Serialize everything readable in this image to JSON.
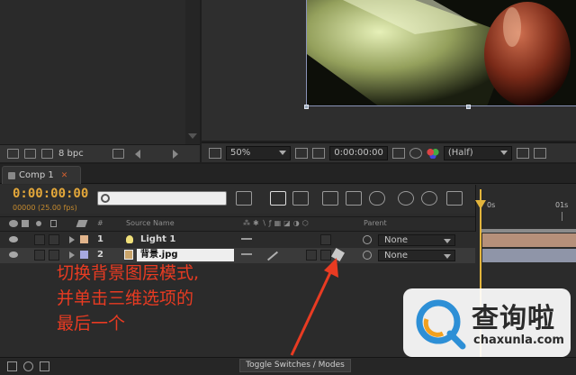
{
  "project_panel": {
    "bit_depth": "8 bpc"
  },
  "viewer_toolbar": {
    "zoom": "50%",
    "timecode": "0:00:00:00",
    "resolution": "(Half)"
  },
  "timeline": {
    "tab": "Comp 1",
    "timecode": "0:00:00:00",
    "fps": "00000 (25.00 fps)",
    "search_placeholder": "",
    "ruler_labels": [
      "0s",
      "01s"
    ],
    "columns": {
      "index": "#",
      "source_name": "Source Name",
      "parent": "Parent"
    },
    "layers": [
      {
        "index": "1",
        "name": "Light 1",
        "label_color": "#e2b58c",
        "parent": "None"
      },
      {
        "index": "2",
        "name": "背景.jpg",
        "label_color": "#a7a9e0",
        "parent": "None"
      }
    ],
    "toggle_label": "Toggle Switches / Modes"
  },
  "annotation": {
    "lines": [
      "切换背景图层模式,",
      "并单击三维选项的",
      "最后一个"
    ]
  },
  "watermark": {
    "title": "查询啦",
    "url": "chaxunla.com"
  },
  "colors": {
    "timecode": "#e3a73a",
    "annotation": "#e83b22",
    "playhead": "#e2b43c",
    "watermark_blue": "#2d8fd6"
  }
}
